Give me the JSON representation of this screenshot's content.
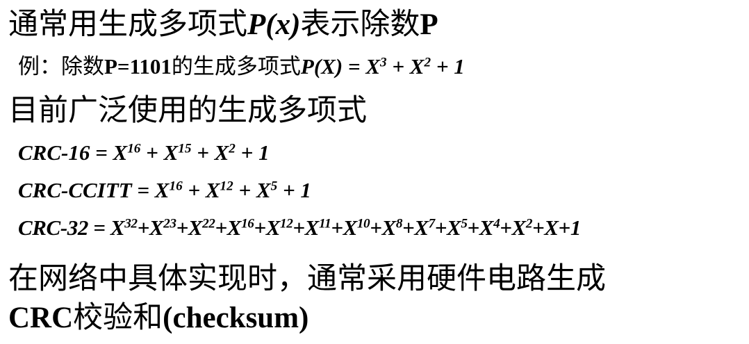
{
  "line1": {
    "text": "通常用生成多项式",
    "px": "P(x)",
    "text2": "表示除数",
    "p": "P"
  },
  "line2": {
    "prefix": "例：除数",
    "p_eq": "P=1101",
    "text": "的生成多项式",
    "formula_lhs": "P(X) = X",
    "exp1": "3",
    "mid": " + X",
    "exp2": "2",
    "tail": " + 1"
  },
  "line3": {
    "text": "目前广泛使用的生成多项式"
  },
  "crc16": {
    "name": "CRC-16 = X",
    "e1": "16",
    "p1": " + X",
    "e2": "15",
    "p2": " + X",
    "e3": "2",
    "tail": " + 1"
  },
  "ccitt": {
    "name": "CRC-CCITT = X",
    "e1": "16",
    "p1": " + X",
    "e2": "12",
    "p2": " + X",
    "e3": "5",
    "tail": " + 1"
  },
  "crc32": {
    "name": "CRC-32 = X",
    "terms": [
      "32",
      "23",
      "22",
      "16",
      "12",
      "11",
      "10",
      "8",
      "7",
      "5",
      "4",
      "2"
    ],
    "joiner": "+X",
    "tail": "+X+1"
  },
  "line7": {
    "text": "在网络中具体实现时，通常采用硬件电路生成"
  },
  "line8": {
    "crc": "CRC",
    "text": "校验和",
    "paren": "(checksum)"
  }
}
